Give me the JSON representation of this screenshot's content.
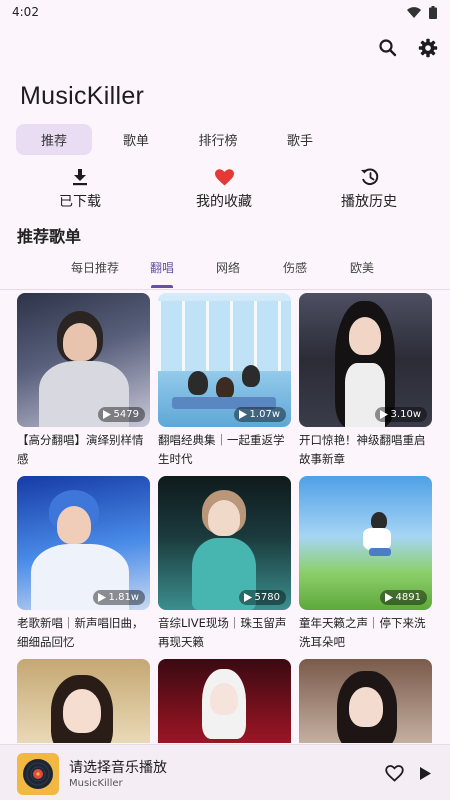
{
  "status": {
    "time": "4:02"
  },
  "header": {
    "app_title": "MusicKiller"
  },
  "top_tabs": [
    {
      "label": "推荐",
      "active": true
    },
    {
      "label": "歌单",
      "active": false
    },
    {
      "label": "排行榜",
      "active": false
    },
    {
      "label": "歌手",
      "active": false
    }
  ],
  "quick_actions": [
    {
      "label": "已下载",
      "icon": "download-icon"
    },
    {
      "label": "我的收藏",
      "icon": "heart-icon"
    },
    {
      "label": "播放历史",
      "icon": "history-icon"
    }
  ],
  "section": {
    "title": "推荐歌单"
  },
  "sub_tabs": [
    {
      "label": "每日推荐",
      "active": false
    },
    {
      "label": "翻唱",
      "active": true
    },
    {
      "label": "网络",
      "active": false
    },
    {
      "label": "伤感",
      "active": false
    },
    {
      "label": "欧美",
      "active": false
    }
  ],
  "playlists": [
    {
      "title": "【高分翻唱】演绎别样情感",
      "plays": "5479"
    },
    {
      "title": "翻唱经典集｜一起重返学生时代",
      "plays": "1.07w"
    },
    {
      "title": "开口惊艳！神级翻唱重启故事新章",
      "plays": "3.10w"
    },
    {
      "title": "老歌新唱｜新声唱旧曲，细细品回忆",
      "plays": "1.81w"
    },
    {
      "title": "音综LIVE现场｜珠玉留声再现天籁",
      "plays": "5780"
    },
    {
      "title": "童年天籁之声｜停下来洗洗耳朵吧",
      "plays": "4891"
    },
    {
      "title": "",
      "plays": ""
    },
    {
      "title": "",
      "plays": ""
    },
    {
      "title": "",
      "plays": ""
    }
  ],
  "player": {
    "title": "请选择音乐播放",
    "subtitle": "MusicKiller",
    "accent": "#6750a4",
    "heart_color": "#e53935"
  }
}
